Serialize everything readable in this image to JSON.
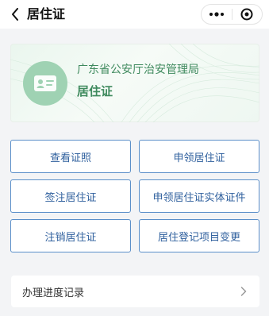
{
  "navbar": {
    "title": "居住证",
    "back_icon": "chevron-left-icon",
    "more_icon": "more-dots-icon",
    "close_icon": "circle-target-icon"
  },
  "card": {
    "organization": "广东省公安厅治安管理局",
    "name": "居住证",
    "icon": "id-card-icon",
    "colors": {
      "icon_bg": "#9fd2b3",
      "text": "#3f8a5e"
    }
  },
  "actions": {
    "view_license": "查看证照",
    "apply_permit": "申领居住证",
    "endorse_permit": "签注居住证",
    "apply_physical_card": "申领居住证实体证件",
    "cancel_permit": "注销居住证",
    "change_registration": "居住登记项目变更"
  },
  "record": {
    "label": "办理进度记录",
    "chevron_icon": "chevron-right-icon"
  },
  "colors": {
    "button_border": "#5b8fc9",
    "button_text": "#2e5f9d"
  }
}
